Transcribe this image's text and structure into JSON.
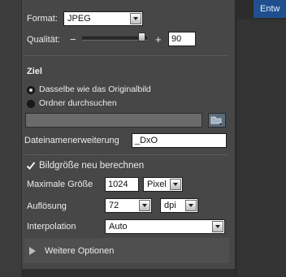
{
  "format": {
    "label": "Format:",
    "value": "JPEG"
  },
  "quality": {
    "label": "Qualität:",
    "minus": "−",
    "plus": "+",
    "value": "90"
  },
  "ziel": {
    "heading": "Ziel",
    "option_same": "Dasselbe wie das Originalbild",
    "option_browse": "Ordner durchsuchen",
    "path_value": ""
  },
  "extension": {
    "label": "Dateinamenerweiterung",
    "value": "_DxO"
  },
  "resize": {
    "checkbox_label": "Bildgröße neu berechnen",
    "checked": true,
    "max_size_label": "Maximale Größe",
    "max_size_value": "1024",
    "max_size_unit": "Pixel",
    "resolution_label": "Auflösung",
    "resolution_value": "72",
    "resolution_unit": "dpi",
    "interpolation_label": "Interpolation",
    "interpolation_value": "Auto"
  },
  "more_options": {
    "label": "Weitere Optionen"
  },
  "right_tab": {
    "label": "Entw"
  }
}
